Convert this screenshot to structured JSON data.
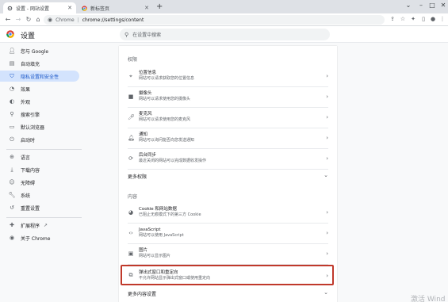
{
  "tabs": [
    {
      "label": "设置 - 网站设置",
      "icon": "gear-icon"
    },
    {
      "label": "新标签页",
      "icon": "chrome-icon"
    }
  ],
  "address": {
    "scheme": "Chrome",
    "path": "chrome://settings/content"
  },
  "header": {
    "title": "设置",
    "search_placeholder": "在设置中搜索"
  },
  "sidebar": {
    "items": [
      {
        "label": "您与 Google",
        "icon": "person-icon"
      },
      {
        "label": "自动填充",
        "icon": "autofill-icon"
      },
      {
        "label": "隐私设置和安全性",
        "icon": "shield-icon"
      },
      {
        "label": "效果",
        "icon": "performance-icon"
      },
      {
        "label": "外观",
        "icon": "palette-icon"
      },
      {
        "label": "搜索引擎",
        "icon": "search-icon"
      },
      {
        "label": "默认浏览器",
        "icon": "browser-icon"
      },
      {
        "label": "启动时",
        "icon": "power-icon"
      },
      {
        "label": "语言",
        "icon": "globe-icon"
      },
      {
        "label": "下载内容",
        "icon": "download-icon"
      },
      {
        "label": "无障碍",
        "icon": "accessibility-icon"
      },
      {
        "label": "系统",
        "icon": "wrench-icon"
      },
      {
        "label": "重置设置",
        "icon": "reset-icon"
      },
      {
        "label": "扩展程序",
        "icon": "puzzle-icon"
      },
      {
        "label": "关于 Chrome",
        "icon": "chrome-icon"
      }
    ]
  },
  "content": {
    "permissions_label": "权限",
    "permissions": [
      {
        "title": "位置信息",
        "subtitle": "网站可以请求获取您的位置信息",
        "icon": "location-icon"
      },
      {
        "title": "摄像头",
        "subtitle": "网站可以请求使用您的摄像头",
        "icon": "camera-icon"
      },
      {
        "title": "麦克风",
        "subtitle": "网站可以请求使用您的麦克风",
        "icon": "mic-icon"
      },
      {
        "title": "通知",
        "subtitle": "网站可以询问能否向您发送通知",
        "icon": "bell-icon"
      },
      {
        "title": "后台同步",
        "subtitle": "最近关闭的网站可以完成数据收发操作",
        "icon": "sync-icon"
      }
    ],
    "more_permissions": "更多权限",
    "content_label": "内容",
    "content_items": [
      {
        "title": "Cookie 和网站数据",
        "subtitle": "已阻止无痕模式下的第三方 Cookie",
        "icon": "cookie-icon"
      },
      {
        "title": "JavaScript",
        "subtitle": "网站可以使用 JavaScript",
        "icon": "code-icon"
      },
      {
        "title": "图片",
        "subtitle": "网站可以显示图片",
        "icon": "image-icon"
      },
      {
        "title": "弹出式窗口和重定向",
        "subtitle": "不允许网站显示弹出式窗口或使用重定向",
        "icon": "popup-icon"
      }
    ],
    "more_content": "更多内容设置"
  },
  "watermark": "激活 Wind"
}
